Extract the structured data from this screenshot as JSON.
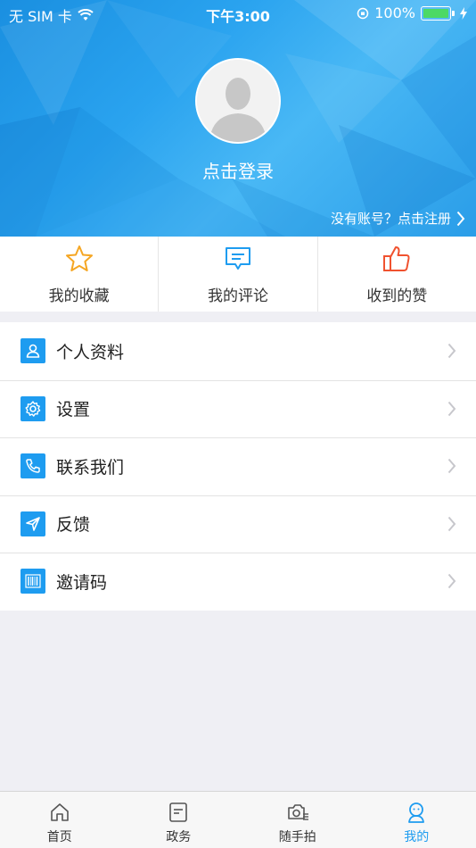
{
  "status_bar": {
    "carrier": "无 SIM 卡",
    "time": "下午3:00",
    "battery": "100%"
  },
  "profile": {
    "login_label": "点击登录",
    "register_label": "没有账号？点击注册"
  },
  "quick_actions": [
    {
      "label": "我的收藏",
      "icon": "star-icon",
      "color": "#f5a623"
    },
    {
      "label": "我的评论",
      "icon": "comment-icon",
      "color": "#1e9cf0"
    },
    {
      "label": "收到的赞",
      "icon": "thumbs-up-icon",
      "color": "#f0522f"
    }
  ],
  "menu": [
    {
      "label": "个人资料",
      "icon": "person-icon"
    },
    {
      "label": "设置",
      "icon": "gear-icon"
    },
    {
      "label": "联系我们",
      "icon": "phone-icon"
    },
    {
      "label": "反馈",
      "icon": "send-icon"
    },
    {
      "label": "邀请码",
      "icon": "barcode-icon"
    }
  ],
  "tabbar": [
    {
      "label": "首页",
      "icon": "home-icon",
      "active": false
    },
    {
      "label": "政务",
      "icon": "document-icon",
      "active": false
    },
    {
      "label": "随手拍",
      "icon": "camera-icon",
      "active": false
    },
    {
      "label": "我的",
      "icon": "profile-icon",
      "active": true
    }
  ],
  "colors": {
    "accent": "#1e9cf0",
    "header_blue": "#2aa3ef",
    "background": "#efeff4"
  }
}
